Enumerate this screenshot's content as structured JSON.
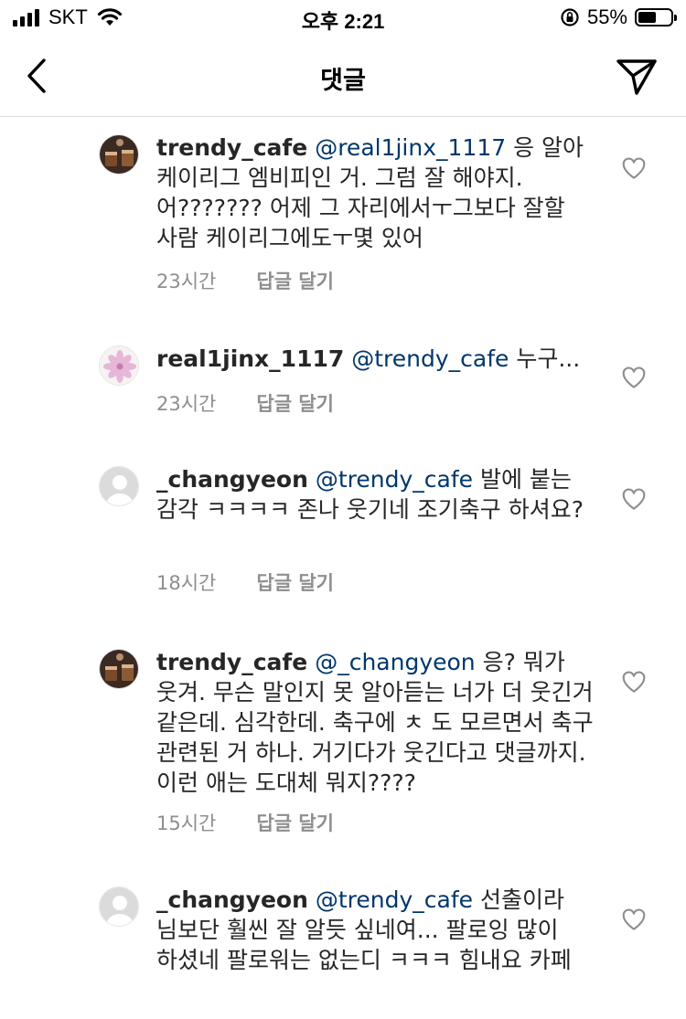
{
  "status_bar": {
    "carrier": "SKT",
    "time": "오후 2:21",
    "battery_percent": "55%",
    "battery_level": 0.55
  },
  "header": {
    "title": "댓글",
    "back_icon": "chevron-left-icon",
    "share_icon": "paper-plane-icon"
  },
  "comments": [
    {
      "username": "trendy_cafe",
      "mention": "@real1jinx_1117",
      "text": "응 알아 케이리그 엠비피인  거. 그럼 잘 해야지. 어??????? 어제 그 자리에서ㅜ그보다 잘할 사람 케이리그에도ㅜ몇 있어",
      "time": "23시간",
      "reply_label": "답글 달기",
      "avatar": "coffee-cups-avatar"
    },
    {
      "username": "real1jinx_1117",
      "mention": "@trendy_cafe",
      "text": "누구...",
      "time": "23시간",
      "reply_label": "답글 달기",
      "avatar": "flower-avatar"
    },
    {
      "username": "_changyeon",
      "mention": "@trendy_cafe",
      "text": "발에 붙는 감각 ㅋㅋㅋㅋ 존나 웃기네 조기축구 하셔요?",
      "time": "18시간",
      "reply_label": "답글 달기",
      "avatar": "default-avatar"
    },
    {
      "username": "trendy_cafe",
      "mention": "@_changyeon",
      "text": "응? 뭐가 웃겨. 무슨 말인지 못 알아듣는 너가 더 웃긴거 같은데. 심각한데. 축구에 ㅊ 도 모르면서 축구 관련된 거 하나. 거기다가 웃긴다고 댓글까지. 이런 애는 도대체 뭐지????",
      "time": "15시간",
      "reply_label": "답글 달기",
      "avatar": "coffee-cups-avatar"
    },
    {
      "username": "_changyeon",
      "mention": "@trendy_cafe",
      "text": "선출이라 님보단 훨씬 잘 알듯 싶네여... 팔로잉 많이 하셨네 팔로워는 없는디 ㅋㅋㅋ 힘내요 카페",
      "avatar": "default-avatar"
    }
  ],
  "colors": {
    "text": "#262626",
    "mention": "#00376b",
    "meta": "#8e8e8e",
    "divider": "#dbdbdb"
  }
}
